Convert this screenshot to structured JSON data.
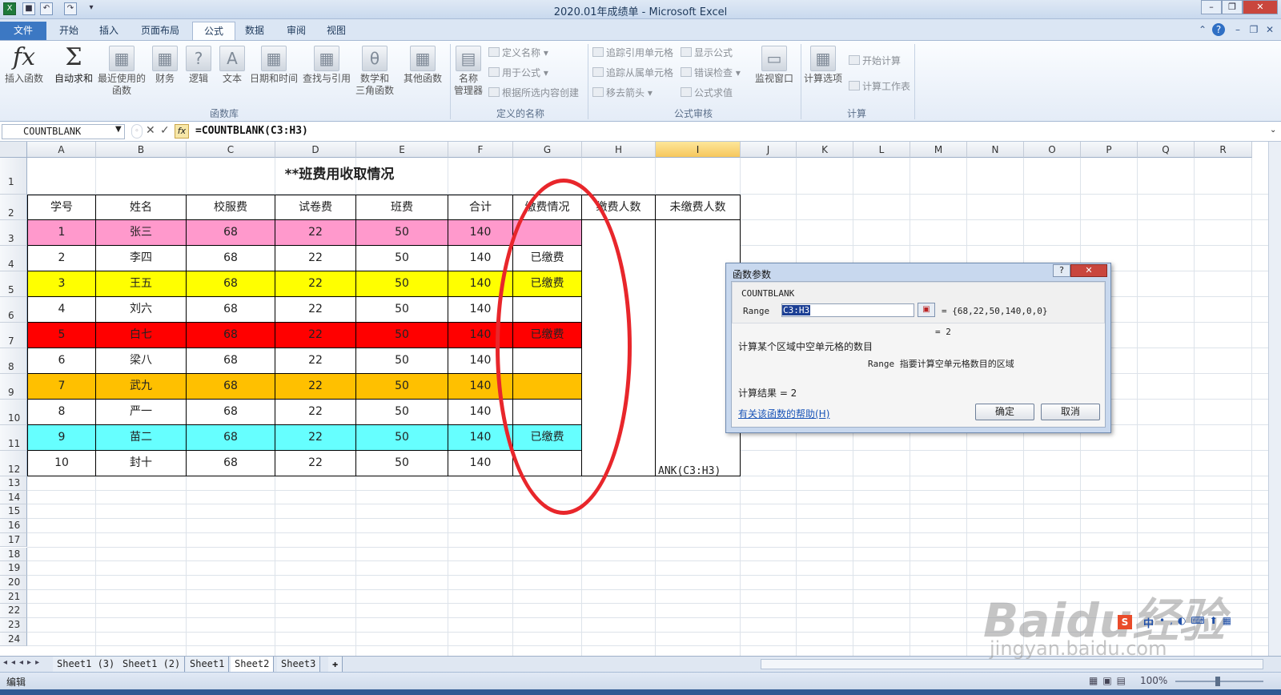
{
  "window": {
    "title": "2020.01年成绩单 - Microsoft Excel"
  },
  "ribbon_tabs": [
    "文件",
    "开始",
    "插入",
    "页面布局",
    "公式",
    "数据",
    "审阅",
    "视图"
  ],
  "ribbon": {
    "function_library": {
      "insert_function": "插入函数",
      "autosum": "自动求和",
      "recent": [
        "最近使用的",
        "函数"
      ],
      "financial": "财务",
      "logical": "逻辑",
      "text": "文本",
      "datetime": "日期和时间",
      "lookup": "查找与引用",
      "math": [
        "数学和",
        "三角函数"
      ],
      "more": "其他函数",
      "group_label": "函数库"
    },
    "defined_names": {
      "name_manager": [
        "名称",
        "管理器"
      ],
      "define_name": "定义名称",
      "use_in_formula": "用于公式",
      "create_from_selection": "根据所选内容创建",
      "group_label": "定义的名称"
    },
    "formula_auditing": {
      "trace_precedents": "追踪引用单元格",
      "trace_dependents": "追踪从属单元格",
      "remove_arrows": "移去箭头",
      "show_formulas": "显示公式",
      "error_checking": "错误检查",
      "evaluate_formula": "公式求值",
      "watch_window": "监视窗口",
      "group_label": "公式审核"
    },
    "calculation": {
      "options": "计算选项",
      "calc_now": "开始计算",
      "calc_sheet": "计算工作表",
      "group_label": "计算"
    }
  },
  "formula_bar": {
    "name_box": "COUNTBLANK",
    "formula": "=COUNTBLANK(C3:H3)"
  },
  "sheet": {
    "columns": [
      "A",
      "B",
      "C",
      "D",
      "E",
      "F",
      "G",
      "H",
      "I",
      "J",
      "K",
      "L",
      "M",
      "N",
      "O",
      "P",
      "Q",
      "R"
    ],
    "rows": [
      "1",
      "2",
      "3",
      "4",
      "5",
      "6",
      "7",
      "8",
      "9",
      "10",
      "11",
      "12",
      "13",
      "14",
      "15",
      "16",
      "17",
      "18",
      "19",
      "20",
      "21",
      "22",
      "23",
      "24"
    ],
    "title": "**班费用收取情况",
    "headers": [
      "学号",
      "姓名",
      "校服费",
      "试卷费",
      "班费",
      "合计",
      "缴费情况",
      "缴费人数",
      "未缴费人数"
    ],
    "data": [
      {
        "no": "1",
        "name": "张三",
        "uniform": "68",
        "exam": "22",
        "class_fee": "50",
        "total": "140",
        "status": "",
        "bg": "#ff99cc"
      },
      {
        "no": "2",
        "name": "李四",
        "uniform": "68",
        "exam": "22",
        "class_fee": "50",
        "total": "140",
        "status": "已缴费",
        "bg": "#ffffff"
      },
      {
        "no": "3",
        "name": "王五",
        "uniform": "68",
        "exam": "22",
        "class_fee": "50",
        "total": "140",
        "status": "已缴费",
        "bg": "#ffff00"
      },
      {
        "no": "4",
        "name": "刘六",
        "uniform": "68",
        "exam": "22",
        "class_fee": "50",
        "total": "140",
        "status": "",
        "bg": "#ffffff"
      },
      {
        "no": "5",
        "name": "白七",
        "uniform": "68",
        "exam": "22",
        "class_fee": "50",
        "total": "140",
        "status": "已缴费",
        "bg": "#ff0000"
      },
      {
        "no": "6",
        "name": "梁八",
        "uniform": "68",
        "exam": "22",
        "class_fee": "50",
        "total": "140",
        "status": "",
        "bg": "#ffffff"
      },
      {
        "no": "7",
        "name": "武九",
        "uniform": "68",
        "exam": "22",
        "class_fee": "50",
        "total": "140",
        "status": "",
        "bg": "#ffc000"
      },
      {
        "no": "8",
        "name": "严一",
        "uniform": "68",
        "exam": "22",
        "class_fee": "50",
        "total": "140",
        "status": "",
        "bg": "#ffffff"
      },
      {
        "no": "9",
        "name": "苗二",
        "uniform": "68",
        "exam": "22",
        "class_fee": "50",
        "total": "140",
        "status": "已缴费",
        "bg": "#66ffff"
      },
      {
        "no": "10",
        "name": "封十",
        "uniform": "68",
        "exam": "22",
        "class_fee": "50",
        "total": "140",
        "status": "",
        "bg": "#ffffff"
      }
    ],
    "editing_cell_text": "ANK(C3:H3)"
  },
  "dialog": {
    "title": "函数参数",
    "function_name": "COUNTBLANK",
    "arg_label": "Range",
    "arg_value": "C3:H3",
    "arg_result": "= {68,22,50,140,0,0}",
    "result_line": "= 2",
    "description": "计算某个区域中空单元格的数目",
    "arg_description": "Range  指要计算空单元格数目的区域",
    "calc_result": "计算结果 = 2",
    "help_link": "有关该函数的帮助(H)",
    "ok": "确定",
    "cancel": "取消"
  },
  "sheet_tabs": [
    "Sheet1 (3)",
    "Sheet1 (2)",
    "Sheet1",
    "Sheet2",
    "Sheet3"
  ],
  "active_sheet": "Sheet2",
  "status": {
    "mode": "编辑",
    "zoom": "100%"
  },
  "watermark": {
    "brand": "Baidu经验",
    "url": "jingyan.baidu.com"
  },
  "ime_label": "中",
  "annotation_color": "#e8262b"
}
